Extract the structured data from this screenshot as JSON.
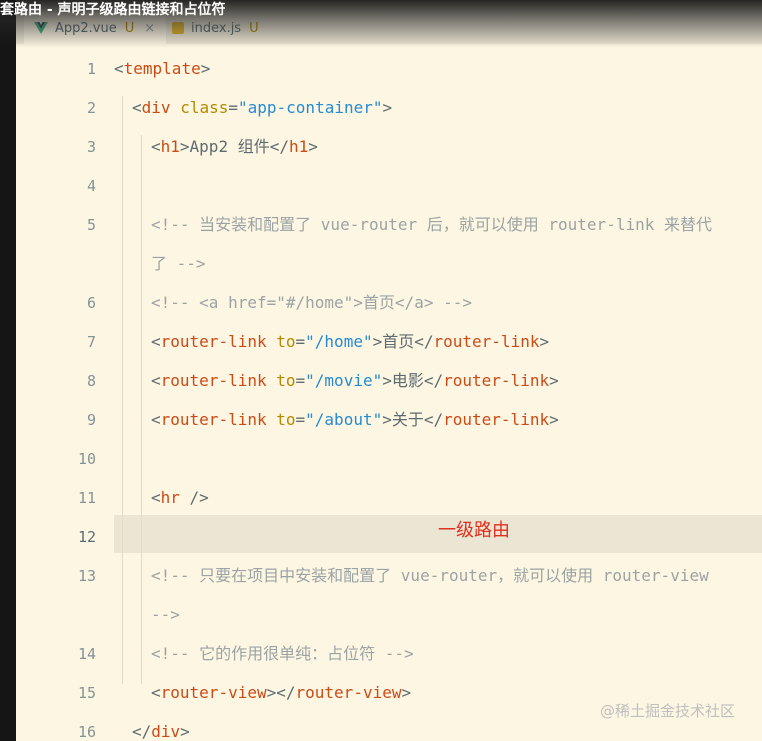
{
  "window_title": "套路由 - 声明子级路由链接和占位符",
  "tabs": [
    {
      "label": "App2.vue",
      "modified": "U",
      "close": "×",
      "icon": "vue-icon",
      "active": true
    },
    {
      "label": "index.js",
      "modified": "U",
      "icon": "js-icon",
      "active": false
    }
  ],
  "lines": [
    {
      "num": "1",
      "code": "<template>"
    },
    {
      "num": "2",
      "code": "<div class=\"app-container\">"
    },
    {
      "num": "3",
      "code": "<h1>App2 组件</h1>"
    },
    {
      "num": "4",
      "code": ""
    },
    {
      "num": "5",
      "code": "<!-- 当安装和配置了 vue-router 后，就可以使用 router-link 来替代",
      "wrap": "了 -->"
    },
    {
      "num": "6",
      "code": "<!-- <a href=\"#/home\">首页</a> -->"
    },
    {
      "num": "7",
      "code": "<router-link to=\"/home\">首页</router-link>"
    },
    {
      "num": "8",
      "code": "<router-link to=\"/movie\">电影</router-link>"
    },
    {
      "num": "9",
      "code": "<router-link to=\"/about\">关于</router-link>"
    },
    {
      "num": "10",
      "code": ""
    },
    {
      "num": "11",
      "code": "<hr />"
    },
    {
      "num": "12",
      "code": ""
    },
    {
      "num": "13",
      "code": "<!-- 只要在项目中安装和配置了 vue-router，就可以使用 router-view",
      "wrap": "-->"
    },
    {
      "num": "14",
      "code": "<!-- 它的作用很单纯：占位符 -->"
    },
    {
      "num": "15",
      "code": "<router-view></router-view>"
    },
    {
      "num": "16",
      "code": "</div>"
    }
  ],
  "annotation": "一级路由",
  "watermark": "@稀土掘金技术社区",
  "colors": {
    "background": "#fdf6e3",
    "tag": "#cb4b16",
    "attribute": "#b58900",
    "string": "#268bd2",
    "comment": "#9aa4a4",
    "annotation": "#e0301e"
  }
}
